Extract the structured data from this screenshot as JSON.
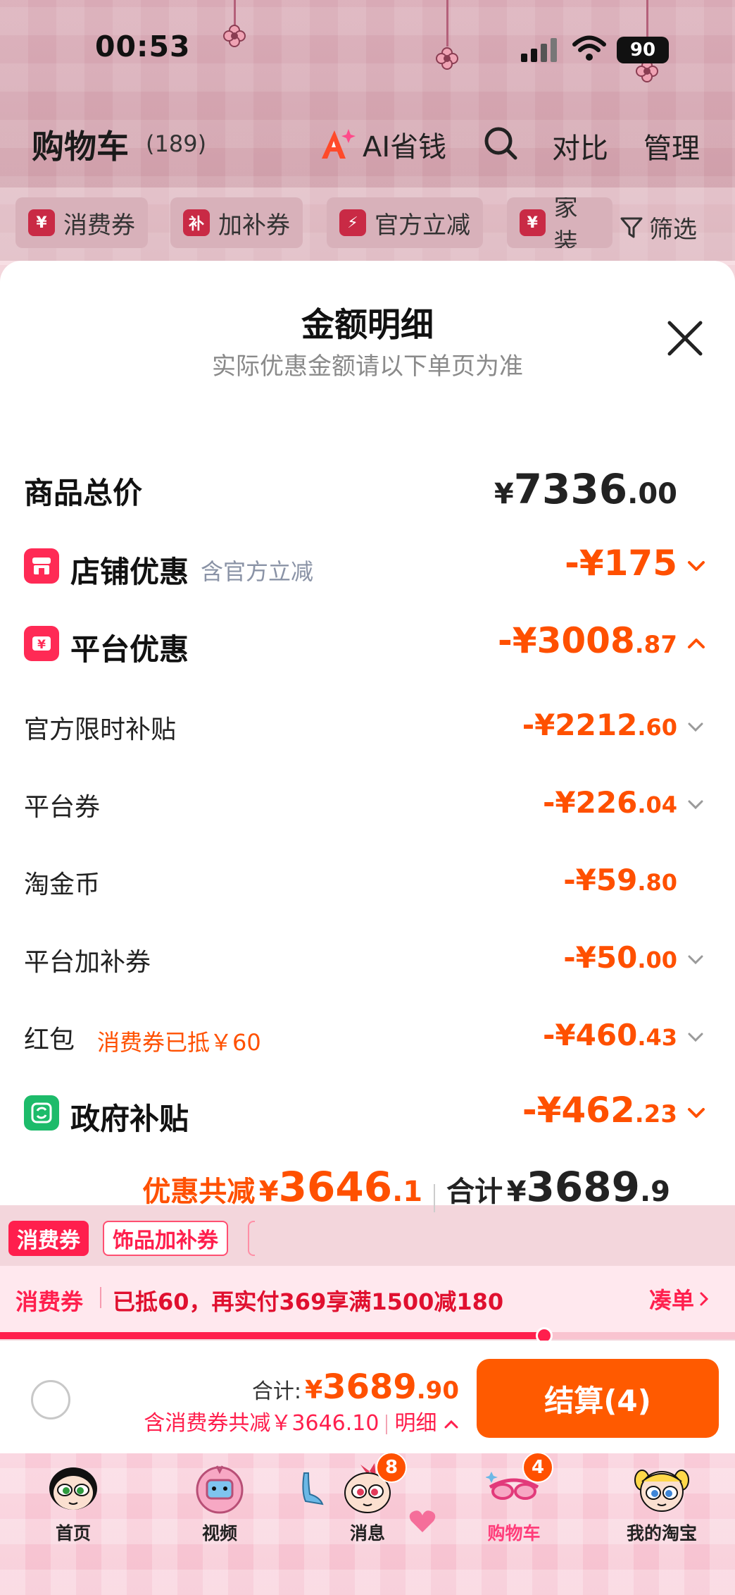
{
  "status_bar": {
    "time": "00:53",
    "battery": "90"
  },
  "header": {
    "title": "购物车",
    "count": "(189)",
    "ai_save_label": "AI省钱",
    "compare_label": "对比",
    "manage_label": "管理"
  },
  "filters": {
    "chips": [
      {
        "icon_text": "¥",
        "label": "消费券"
      },
      {
        "icon_text": "补",
        "label": "加补券"
      },
      {
        "icon_text": "⚡",
        "label": "官方立减"
      },
      {
        "icon_text": "¥",
        "label": "家装"
      }
    ],
    "filter_label": "筛选"
  },
  "sheet": {
    "title": "金额明细",
    "subtitle": "实际优惠金额请以下单页为准",
    "total": {
      "label": "商品总价",
      "symbol": "¥",
      "int": "7336",
      "dec": ".00"
    },
    "store_discount": {
      "label": "店铺优惠",
      "note": "含官方立减",
      "prefix": "-¥",
      "int": "175",
      "dec": ""
    },
    "platform_discount": {
      "label": "平台优惠",
      "prefix": "-¥",
      "int": "3008",
      "dec": ".87"
    },
    "sub_items": [
      {
        "label": "官方限时补贴",
        "prefix": "-¥",
        "int": "2212",
        "dec": ".60",
        "expandable": true
      },
      {
        "label": "平台券",
        "prefix": "-¥",
        "int": "226",
        "dec": ".04",
        "expandable": true
      },
      {
        "label": "淘金币",
        "prefix": "-¥",
        "int": "59",
        "dec": ".80",
        "expandable": false
      },
      {
        "label": "平台加补券",
        "prefix": "-¥",
        "int": "50",
        "dec": ".00",
        "expandable": true
      },
      {
        "label": "红包",
        "note": "消费券已抵￥60",
        "prefix": "-¥",
        "int": "460",
        "dec": ".43",
        "expandable": true
      }
    ],
    "gov_subsidy": {
      "label": "政府补贴",
      "prefix": "-¥",
      "int": "462",
      "dec": ".23"
    },
    "summary": {
      "discount_label": "优惠共减",
      "discount_symbol": "¥",
      "discount_int": "3646",
      "discount_dec": ".1",
      "total_label": "合计",
      "total_symbol": "¥",
      "total_int": "3689",
      "total_dec": ".9"
    }
  },
  "coupon_tags": [
    "消费券",
    "饰品加补券"
  ],
  "coupon_banner": {
    "tag": "消费券",
    "text": "已抵60，再实付369享满1500减180",
    "action": "凑单",
    "progress": 0.74
  },
  "checkout": {
    "total_label": "合计:",
    "symbol": "¥",
    "int": "3689",
    "dec": ".90",
    "note": "含消费券共减￥3646.10",
    "detail_label": "明细",
    "button_label": "结算(4)"
  },
  "tabbar": {
    "items": [
      {
        "label": "首页",
        "badge": ""
      },
      {
        "label": "视频",
        "badge": ""
      },
      {
        "label": "消息",
        "badge": "8"
      },
      {
        "label": "购物车",
        "badge": "4",
        "active": true
      },
      {
        "label": "我的淘宝",
        "badge": ""
      }
    ]
  },
  "colors": {
    "accent_orange": "#ff5000",
    "accent_red": "#ff1f4d",
    "checkout_button": "#ff5a00",
    "store_icon": "#ff2a55",
    "gov_icon": "#1dbb6a"
  }
}
